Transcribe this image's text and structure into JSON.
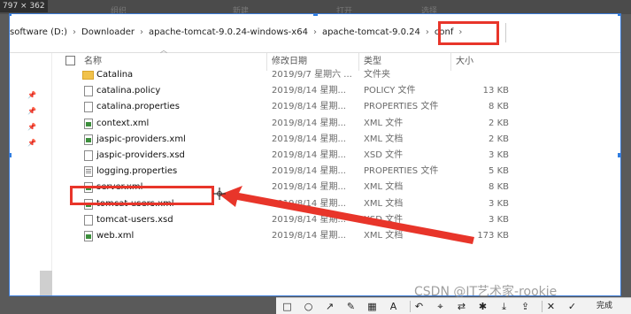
{
  "screen": {
    "dimension_label": "797 × 362",
    "ribbon_labels": [
      "组织",
      "新建",
      "打开",
      "选择"
    ]
  },
  "breadcrumb": {
    "items": [
      "software (D:)",
      "Downloader",
      "apache-tomcat-9.0.24-windows-x64",
      "apache-tomcat-9.0.24",
      "conf"
    ],
    "separator": "›"
  },
  "columns": {
    "name": "名称",
    "date": "修改日期",
    "type": "类型",
    "size": "大小"
  },
  "files": [
    {
      "name": "Catalina",
      "date": "2019/9/7 星期六 ...",
      "type": "文件夹",
      "size": "",
      "icon": "folder-icon"
    },
    {
      "name": "catalina.policy",
      "date": "2019/8/14 星期...",
      "type": "POLICY 文件",
      "size": "13 KB",
      "icon": "file-icon"
    },
    {
      "name": "catalina.properties",
      "date": "2019/8/14 星期...",
      "type": "PROPERTIES 文件",
      "size": "8 KB",
      "icon": "file-icon"
    },
    {
      "name": "context.xml",
      "date": "2019/8/14 星期...",
      "type": "XML 文件",
      "size": "2 KB",
      "icon": "xml-file-icon"
    },
    {
      "name": "jaspic-providers.xml",
      "date": "2019/8/14 星期...",
      "type": "XML 文档",
      "size": "2 KB",
      "icon": "xml-file-icon"
    },
    {
      "name": "jaspic-providers.xsd",
      "date": "2019/8/14 星期...",
      "type": "XSD 文件",
      "size": "3 KB",
      "icon": "file-icon"
    },
    {
      "name": "logging.properties",
      "date": "2019/8/14 星期...",
      "type": "PROPERTIES 文件",
      "size": "5 KB",
      "icon": "properties-file-icon"
    },
    {
      "name": "server.xml",
      "date": "2019/8/14 星期...",
      "type": "XML 文档",
      "size": "8 KB",
      "icon": "xml-file-icon"
    },
    {
      "name": "tomcat-users.xml",
      "date": "2019/8/14 星期...",
      "type": "XML 文档",
      "size": "3 KB",
      "icon": "xml-file-icon"
    },
    {
      "name": "tomcat-users.xsd",
      "date": "2019/8/14 星期...",
      "type": "XSD 文件",
      "size": "3 KB",
      "icon": "file-icon"
    },
    {
      "name": "web.xml",
      "date": "2019/8/14 星期...",
      "type": "XML 文档",
      "size": "173 KB",
      "icon": "xml-file-icon"
    }
  ],
  "annotations": {
    "highlight_color": "#e8352a"
  },
  "capture_toolbar": {
    "done_label": "完成",
    "tools": [
      "rectangle-icon",
      "ellipse-icon",
      "arrow-icon",
      "pen-icon",
      "mosaic-icon",
      "text-icon",
      "undo-icon",
      "pin-icon",
      "translate-icon",
      "mark-icon",
      "download-icon",
      "share-icon",
      "close-icon",
      "confirm-icon"
    ]
  },
  "watermark": "CSDN @IT艺术家-rookie"
}
